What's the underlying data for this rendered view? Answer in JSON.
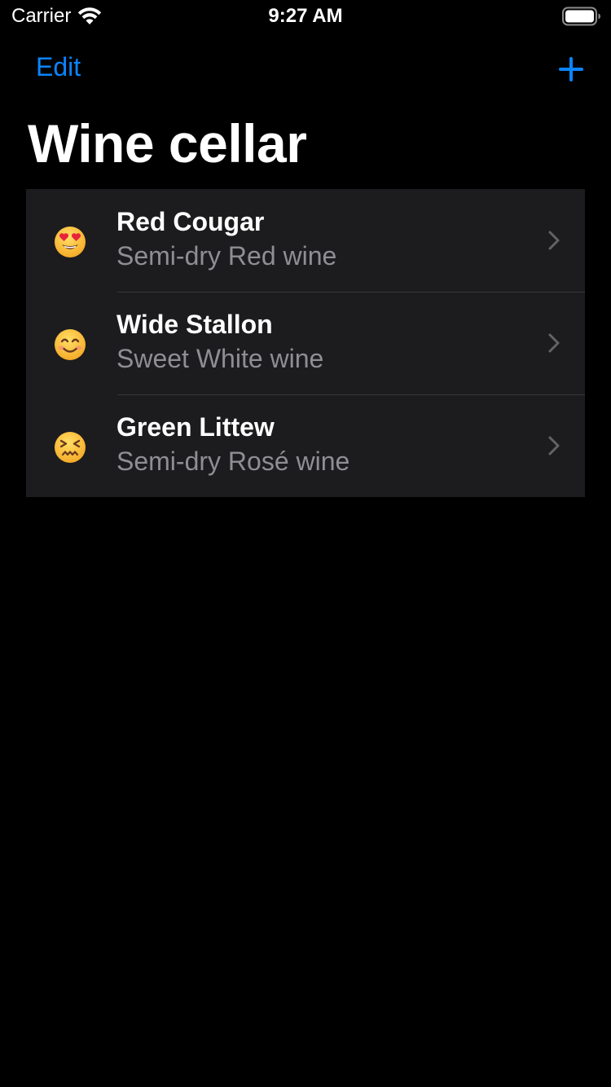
{
  "status_bar": {
    "carrier": "Carrier",
    "time": "9:27 AM"
  },
  "nav": {
    "edit_label": "Edit",
    "add_icon": "plus-icon"
  },
  "title": "Wine cellar",
  "colors": {
    "accent": "#0a84ff",
    "background": "#000000",
    "list_background": "#1c1c1e",
    "secondary_text": "#8e8e93",
    "separator": "#38383a"
  },
  "wines": [
    {
      "emoji": "heart-eyes-emoji",
      "name": "Red Cougar",
      "subtitle": "Semi-dry Red wine"
    },
    {
      "emoji": "smiling-emoji",
      "name": "Wide Stallon",
      "subtitle": "Sweet White wine"
    },
    {
      "emoji": "confounded-emoji",
      "name": "Green Littew",
      "subtitle": "Semi-dry Rosé wine"
    }
  ]
}
